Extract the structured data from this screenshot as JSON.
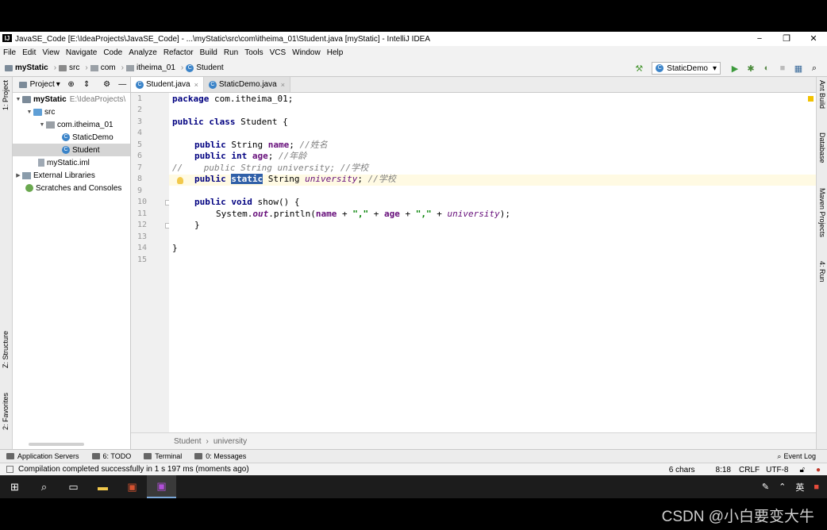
{
  "window": {
    "title": "JavaSE_Code [E:\\IdeaProjects\\JavaSE_Code] - ...\\myStatic\\src\\com\\itheima_01\\Student.java [myStatic] - IntelliJ IDEA",
    "app_icon": "IJ",
    "minimize": "−",
    "maximize": "❐",
    "close": "✕"
  },
  "menu": [
    "File",
    "Edit",
    "View",
    "Navigate",
    "Code",
    "Analyze",
    "Refactor",
    "Build",
    "Run",
    "Tools",
    "VCS",
    "Window",
    "Help"
  ],
  "navbar": {
    "crumbs": [
      "myStatic",
      "src",
      "com",
      "itheima_01",
      "Student"
    ],
    "run_config": "StaticDemo",
    "dropdown": "▾"
  },
  "left_tabs": {
    "project": "1: Project",
    "structure": "Z: Structure",
    "favorites": "2: Favorites"
  },
  "project_panel": {
    "title": "Project",
    "dropdown": "▾",
    "tree": [
      {
        "label": "myStatic",
        "extra": "E:\\IdeaProjects\\",
        "arrow": "▼"
      },
      {
        "label": "src",
        "arrow": "▼"
      },
      {
        "label": "com.itheima_01",
        "arrow": "▼"
      },
      {
        "label": "StaticDemo"
      },
      {
        "label": "Student"
      },
      {
        "label": "myStatic.iml"
      },
      {
        "label": "External Libraries",
        "arrow": "▶"
      },
      {
        "label": "Scratches and Consoles"
      }
    ]
  },
  "tabs": [
    {
      "label": "Student.java",
      "close": "×"
    },
    {
      "label": "StaticDemo.java",
      "close": "×"
    }
  ],
  "code": {
    "line_numbers": [
      "1",
      "2",
      "3",
      "4",
      "5",
      "6",
      "7",
      "8",
      "9",
      "10",
      "11",
      "12",
      "13",
      "14",
      "15"
    ],
    "l1_kw": "package",
    "l1_rest": " com.itheima_01;",
    "l3_kw1": "public",
    "l3_kw2": "class",
    "l3_rest": " Student {",
    "l5_kw": "public",
    "l5_type": " String ",
    "l5_field": "name",
    "l5_semi": "; ",
    "l5_comment": "//姓名",
    "l6_kw1": "public",
    "l6_kw2": "int",
    "l6_field": "age",
    "l6_semi": "; ",
    "l6_comment": "//年龄",
    "l7_comment": "//    public String university; //学校",
    "l8_kw": "public",
    "l8_sel": "static",
    "l8_type": " String ",
    "l8_field": "university",
    "l8_semi": "; ",
    "l8_comment": "//学校",
    "l10_kw1": "public",
    "l10_kw2": "void",
    "l10_rest": " show() {",
    "l11_a": "System.",
    "l11_out": "out",
    "l11_b": ".println(",
    "l11_name": "name",
    "l11_plus1": " + ",
    "l11_str1": "\",\"",
    "l11_plus2": " + ",
    "l11_age": "age",
    "l11_plus3": " + ",
    "l11_str2": "\",\"",
    "l11_plus4": " + ",
    "l11_univ": "university",
    "l11_end": ");",
    "l12": "}",
    "l14": "}"
  },
  "editor_breadcrumb": {
    "cls": "Student",
    "sep": "›",
    "member": "university"
  },
  "right_tabs": {
    "ant": "Ant Build",
    "database": "Database",
    "maven": "Maven Projects",
    "run": "4: Run"
  },
  "tool_windows": [
    {
      "label": "Application Servers"
    },
    {
      "label": "6: TODO"
    },
    {
      "label": "Terminal"
    },
    {
      "label": "0: Messages"
    }
  ],
  "event_log": "Event Log",
  "status": {
    "message": "Compilation completed successfully in 1 s 197 ms (moments ago)",
    "chars": "6 chars",
    "position": "8:18",
    "line_sep": "CRLF",
    "encoding": "UTF-8"
  },
  "taskbar": {
    "ime": "英"
  },
  "watermark": "CSDN @小白要变大牛"
}
